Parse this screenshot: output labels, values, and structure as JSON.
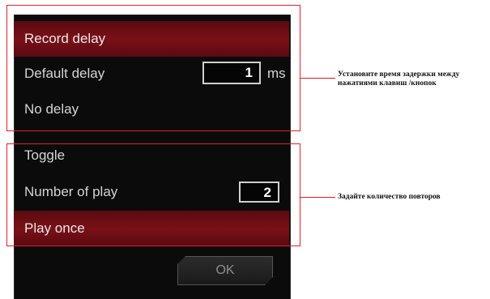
{
  "record_delay": {
    "header": "Record delay",
    "default_delay_label": "Default delay",
    "default_delay_value": "1",
    "unit": "ms",
    "no_delay_label": "No delay"
  },
  "toggle": {
    "header": "Toggle",
    "number_of_play_label": "Number of play",
    "number_of_play_value": "2",
    "play_once_label": "Play once"
  },
  "ok_button": {
    "label": "OK"
  },
  "annotations": {
    "delay_line1": "Установите время задержки между",
    "delay_line2": "нажатиями клавиш /кнопок",
    "repeat": "Задайте количество повторов"
  },
  "colors": {
    "highlight_red": "#7a1018",
    "annotation_red": "#e0202c",
    "panel_bg": "#0b0b0b"
  }
}
